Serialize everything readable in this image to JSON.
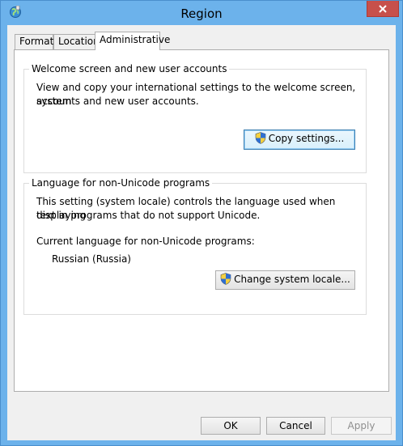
{
  "window": {
    "title": "Region"
  },
  "tabs": [
    {
      "label": "Formats",
      "active": false
    },
    {
      "label": "Location",
      "active": false
    },
    {
      "label": "Administrative",
      "active": true
    }
  ],
  "welcome_group": {
    "title": "Welcome screen and new user accounts",
    "description_line1": "View and copy your international settings to the welcome screen, system",
    "description_line2": "accounts and new user accounts.",
    "button_label": "Copy settings..."
  },
  "unicode_group": {
    "title": "Language for non-Unicode programs",
    "description_line1": "This setting (system locale) controls the language used when displaying",
    "description_line2": "text in programs that do not support Unicode.",
    "current_label": "Current language for non-Unicode programs:",
    "current_value": "Russian (Russia)",
    "button_label": "Change system locale..."
  },
  "footer": {
    "ok_label": "OK",
    "cancel_label": "Cancel",
    "apply_label": "Apply",
    "apply_enabled": false
  },
  "colors": {
    "title_bar": "#6cb2eb",
    "close_button": "#c7504b",
    "dialog_background": "#f0f0f0",
    "panel_background": "#ffffff",
    "disabled_text": "#8f8f8f"
  },
  "icons": {
    "app": "region-globe-icon",
    "close": "close-icon",
    "uac_shield": "uac-shield-icon"
  }
}
